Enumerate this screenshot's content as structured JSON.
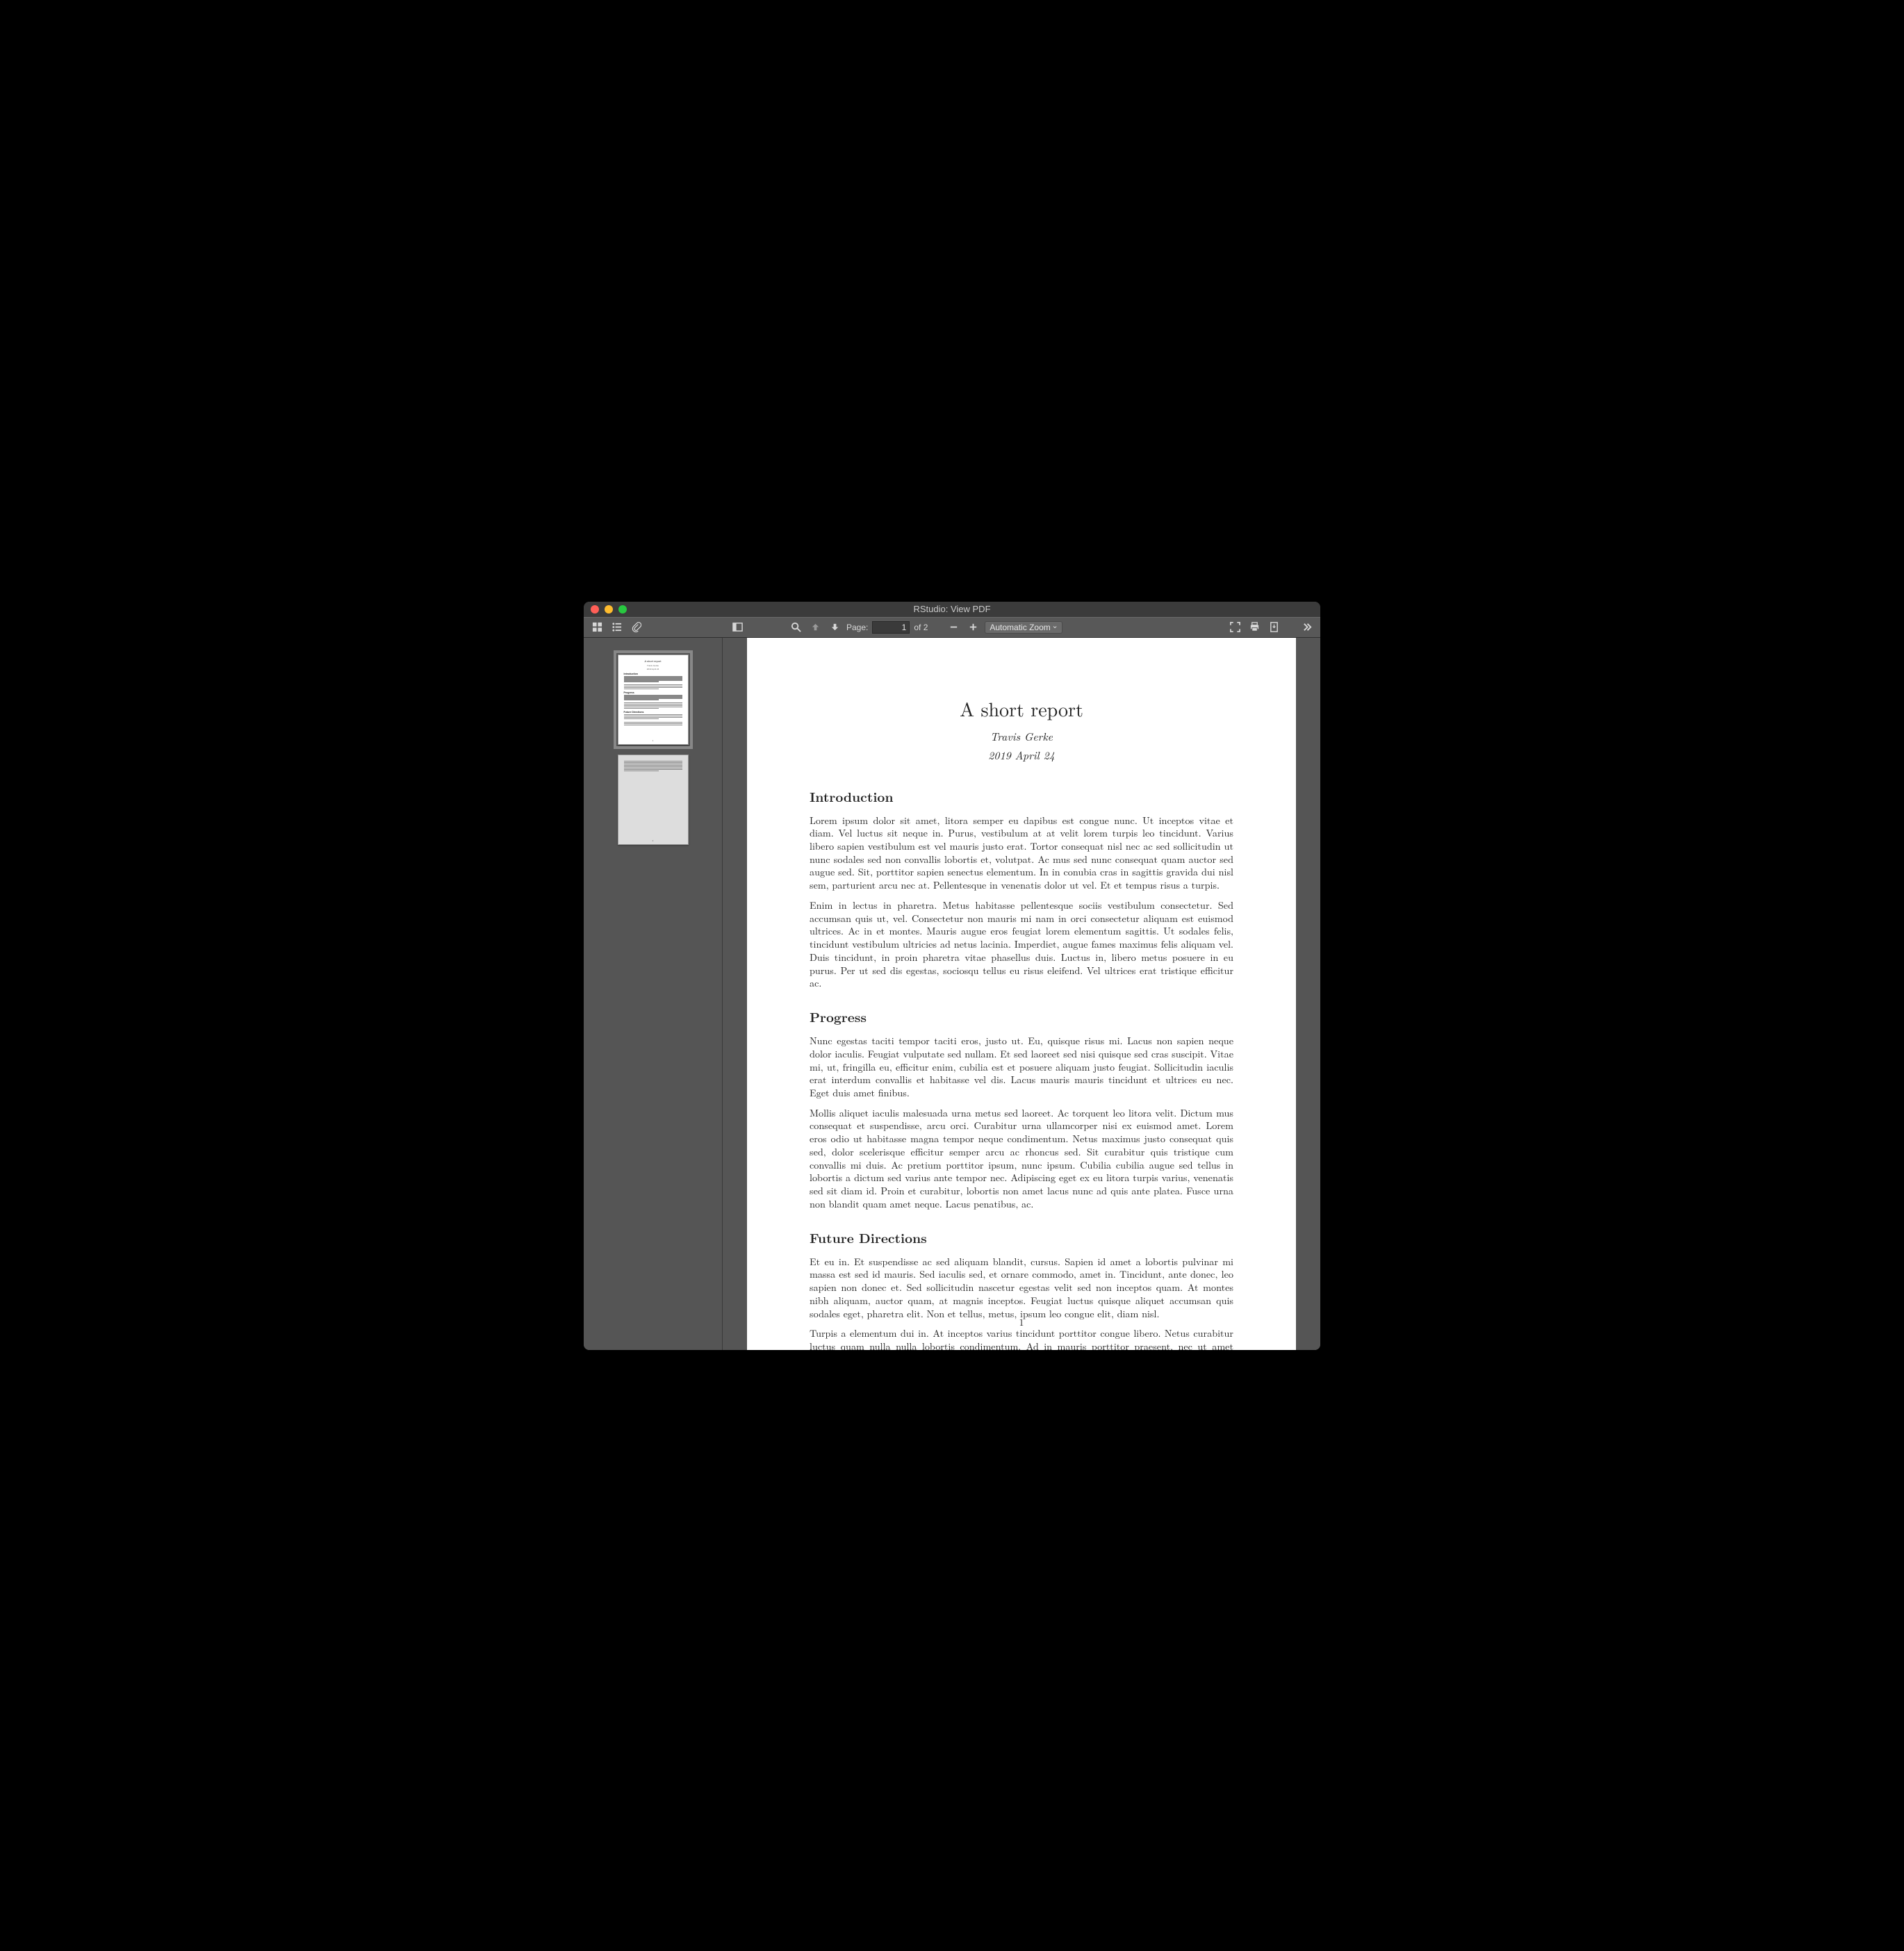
{
  "window": {
    "title": "RStudio: View PDF"
  },
  "toolbar": {
    "page_label": "Page:",
    "page_value": "1",
    "page_total": "of 2",
    "zoom_selected": "Automatic Zoom"
  },
  "thumbnails": [
    {
      "active": true
    },
    {
      "active": false
    }
  ],
  "document": {
    "title": "A short report",
    "author": "Travis Gerke",
    "date": "2019 April 24",
    "page_number": "1",
    "sections": [
      {
        "heading": "Introduction",
        "paragraphs": [
          "Lorem ipsum dolor sit amet, litora semper eu dapibus est congue nunc. Ut inceptos vitae et diam. Vel luctus sit neque in. Purus, vestibulum at at velit lorem turpis leo tincidunt. Varius libero sapien vestibulum est vel mauris justo erat. Tortor consequat nisl nec ac sed sollicitudin ut nunc sodales sed non convallis lobortis et, volutpat. Ac mus sed nunc consequat quam auctor sed augue sed. Sit, porttitor sapien senectus elementum. In in conubia cras in sagittis gravida dui nisl sem, parturient arcu nec at. Pellentesque in venenatis dolor ut vel. Et et tempus risus a turpis.",
          "Enim in lectus in pharetra. Metus habitasse pellentesque sociis vestibulum consectetur. Sed accumsan quis ut, vel. Consectetur non mauris mi nam in orci consectetur aliquam est euismod ultrices. Ac in et montes. Mauris augue eros feugiat lorem elementum sagittis. Ut sodales felis, tincidunt vestibulum ultricies ad netus lacinia. Imperdiet, augue fames maximus felis aliquam vel. Duis tincidunt, in proin pharetra vitae phasellus duis. Luctus in, libero metus posuere in eu purus. Per ut sed dis egestas, sociosqu tellus eu risus eleifend. Vel ultrices erat tristique efficitur ac."
        ]
      },
      {
        "heading": "Progress",
        "paragraphs": [
          "Nunc egestas taciti tempor taciti eros, justo ut. Eu, quisque risus mi. Lacus non sapien neque dolor iaculis. Feugiat vulputate sed nullam. Et sed laoreet sed nisi quisque sed cras suscipit. Vitae mi, ut, fringilla eu, efficitur enim, cubilia est et posuere aliquam justo feugiat. Sollicitudin iaculis erat interdum convallis et habitasse vel dis. Lacus mauris mauris tincidunt et ultrices eu nec. Eget duis amet finibus.",
          "Mollis aliquet iaculis malesuada urna metus sed laoreet. Ac torquent leo litora velit. Dictum mus consequat et suspendisse, arcu orci. Curabitur urna ullamcorper nisi ex euismod amet. Lorem eros odio ut habitasse magna tempor neque condimentum. Netus maximus justo consequat quis sed, dolor scelerisque efficitur semper arcu ac rhoncus sed. Sit curabitur quis tristique cum convallis mi duis. Ac pretium porttitor ipsum, nunc ipsum. Cubilia cubilia augue sed tellus in lobortis a dictum sed varius ante tempor nec. Adipiscing eget ex eu litora turpis varius, venenatis sed sit diam id. Proin et curabitur, lobortis non amet lacus nunc ad quis ante platea. Fusce urna non blandit quam amet neque. Lacus penatibus, ac."
        ]
      },
      {
        "heading": "Future Directions",
        "paragraphs": [
          "Et eu in. Et suspendisse ac sed aliquam blandit, cursus. Sapien id amet a lobortis pulvinar mi massa est sed id mauris. Sed iaculis sed, et ornare commodo, amet in. Tincidunt, ante donec, leo sapien non donec et. Sed sollicitudin nascetur egestas velit sed non inceptos quam. At montes nibh aliquam, auctor quam, at magnis inceptos. Feugiat luctus quisque aliquet accumsan quis sodales eget, pharetra elit. Non et tellus, metus, ipsum leo congue elit, diam nisl.",
          "Turpis a elementum dui in. At inceptos varius tincidunt porttitor congue libero. Netus curabitur luctus quam nulla nulla lobortis condimentum. Ad in mauris porttitor praesent, nec ut amet convallis nec. Vel vitae in habitant, quis enim vitae varius velit venenatis sed lorem. Augue senectus suscipit commodo pretium conubia torquent platea. Tempor rutrum turpis dui ut turpis. Lacinia mauris vivamus magna sit class diam dolor. Mi"
        ]
      }
    ]
  }
}
